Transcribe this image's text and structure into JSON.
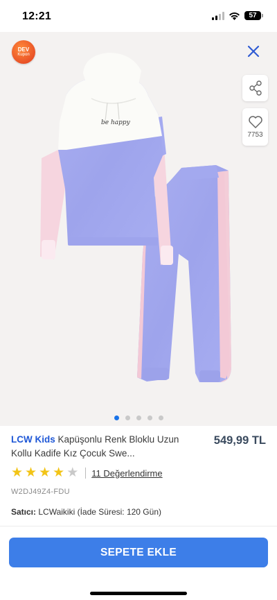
{
  "status_bar": {
    "time": "12:21",
    "battery": "57"
  },
  "coupon": {
    "line1": "DEV",
    "line2": "Kupon"
  },
  "gallery": {
    "favorite_count": "7753",
    "image_total": 5,
    "image_active": 1,
    "print_text": "be happy"
  },
  "product": {
    "brand": "LCW Kids",
    "title": "Kapüşonlu Renk Bloklu Uzun Kollu Kadife Kız Çocuk Swe...",
    "price": "549,99 TL",
    "rating": 4,
    "rating_max": 5,
    "reviews_label": "11 Değerlendirme",
    "sku": "W2DJ49Z4-FDU",
    "seller_label": "Satıcı:",
    "seller_value": "LCWaikiki (İade Süresi: 120 Gün)"
  },
  "actions": {
    "add_to_cart": "SEPETE EKLE"
  },
  "colors": {
    "accent": "#3d7ee8",
    "brand": "#1e57d6",
    "star": "#f2c417",
    "price": "#3a4a5e"
  }
}
